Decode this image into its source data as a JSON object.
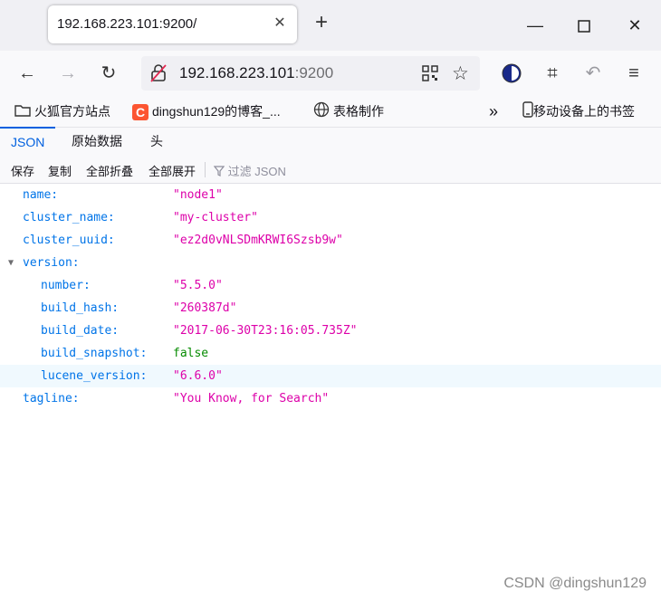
{
  "browser": {
    "tab_title": "192.168.223.101:9200/",
    "url_host": "192.168.223.101",
    "url_port": ":9200",
    "bookmarks": [
      {
        "label": "火狐官方站点",
        "icon": "folder-icon"
      },
      {
        "label": "dingshun129的博客_...",
        "icon": "csdn-icon"
      },
      {
        "label": "表格制作",
        "icon": "globe-icon"
      }
    ],
    "mobile_bookmarks": "移动设备上的书签"
  },
  "viewer": {
    "tabs": [
      "JSON",
      "原始数据",
      "头"
    ],
    "toolbar": [
      "保存",
      "复制",
      "全部折叠",
      "全部展开"
    ],
    "filter_placeholder": "过滤 JSON"
  },
  "json": {
    "rows": [
      {
        "key": "name:",
        "value": "\"node1\"",
        "type": "string"
      },
      {
        "key": "cluster_name:",
        "value": "\"my-cluster\"",
        "type": "string"
      },
      {
        "key": "cluster_uuid:",
        "value": "\"ez2d0vNLSDmKRWI6Szsb9w\"",
        "type": "string"
      },
      {
        "key": "version:",
        "value": "",
        "type": "object"
      },
      {
        "key": "number:",
        "value": "\"5.5.0\"",
        "type": "string"
      },
      {
        "key": "build_hash:",
        "value": "\"260387d\"",
        "type": "string"
      },
      {
        "key": "build_date:",
        "value": "\"2017-06-30T23:16:05.735Z\"",
        "type": "string"
      },
      {
        "key": "build_snapshot:",
        "value": "false",
        "type": "bool"
      },
      {
        "key": "lucene_version:",
        "value": "\"6.6.0\"",
        "type": "string"
      },
      {
        "key": "tagline:",
        "value": "\"You Know, for Search\"",
        "type": "string"
      }
    ]
  },
  "watermark": "CSDN @dingshun129"
}
